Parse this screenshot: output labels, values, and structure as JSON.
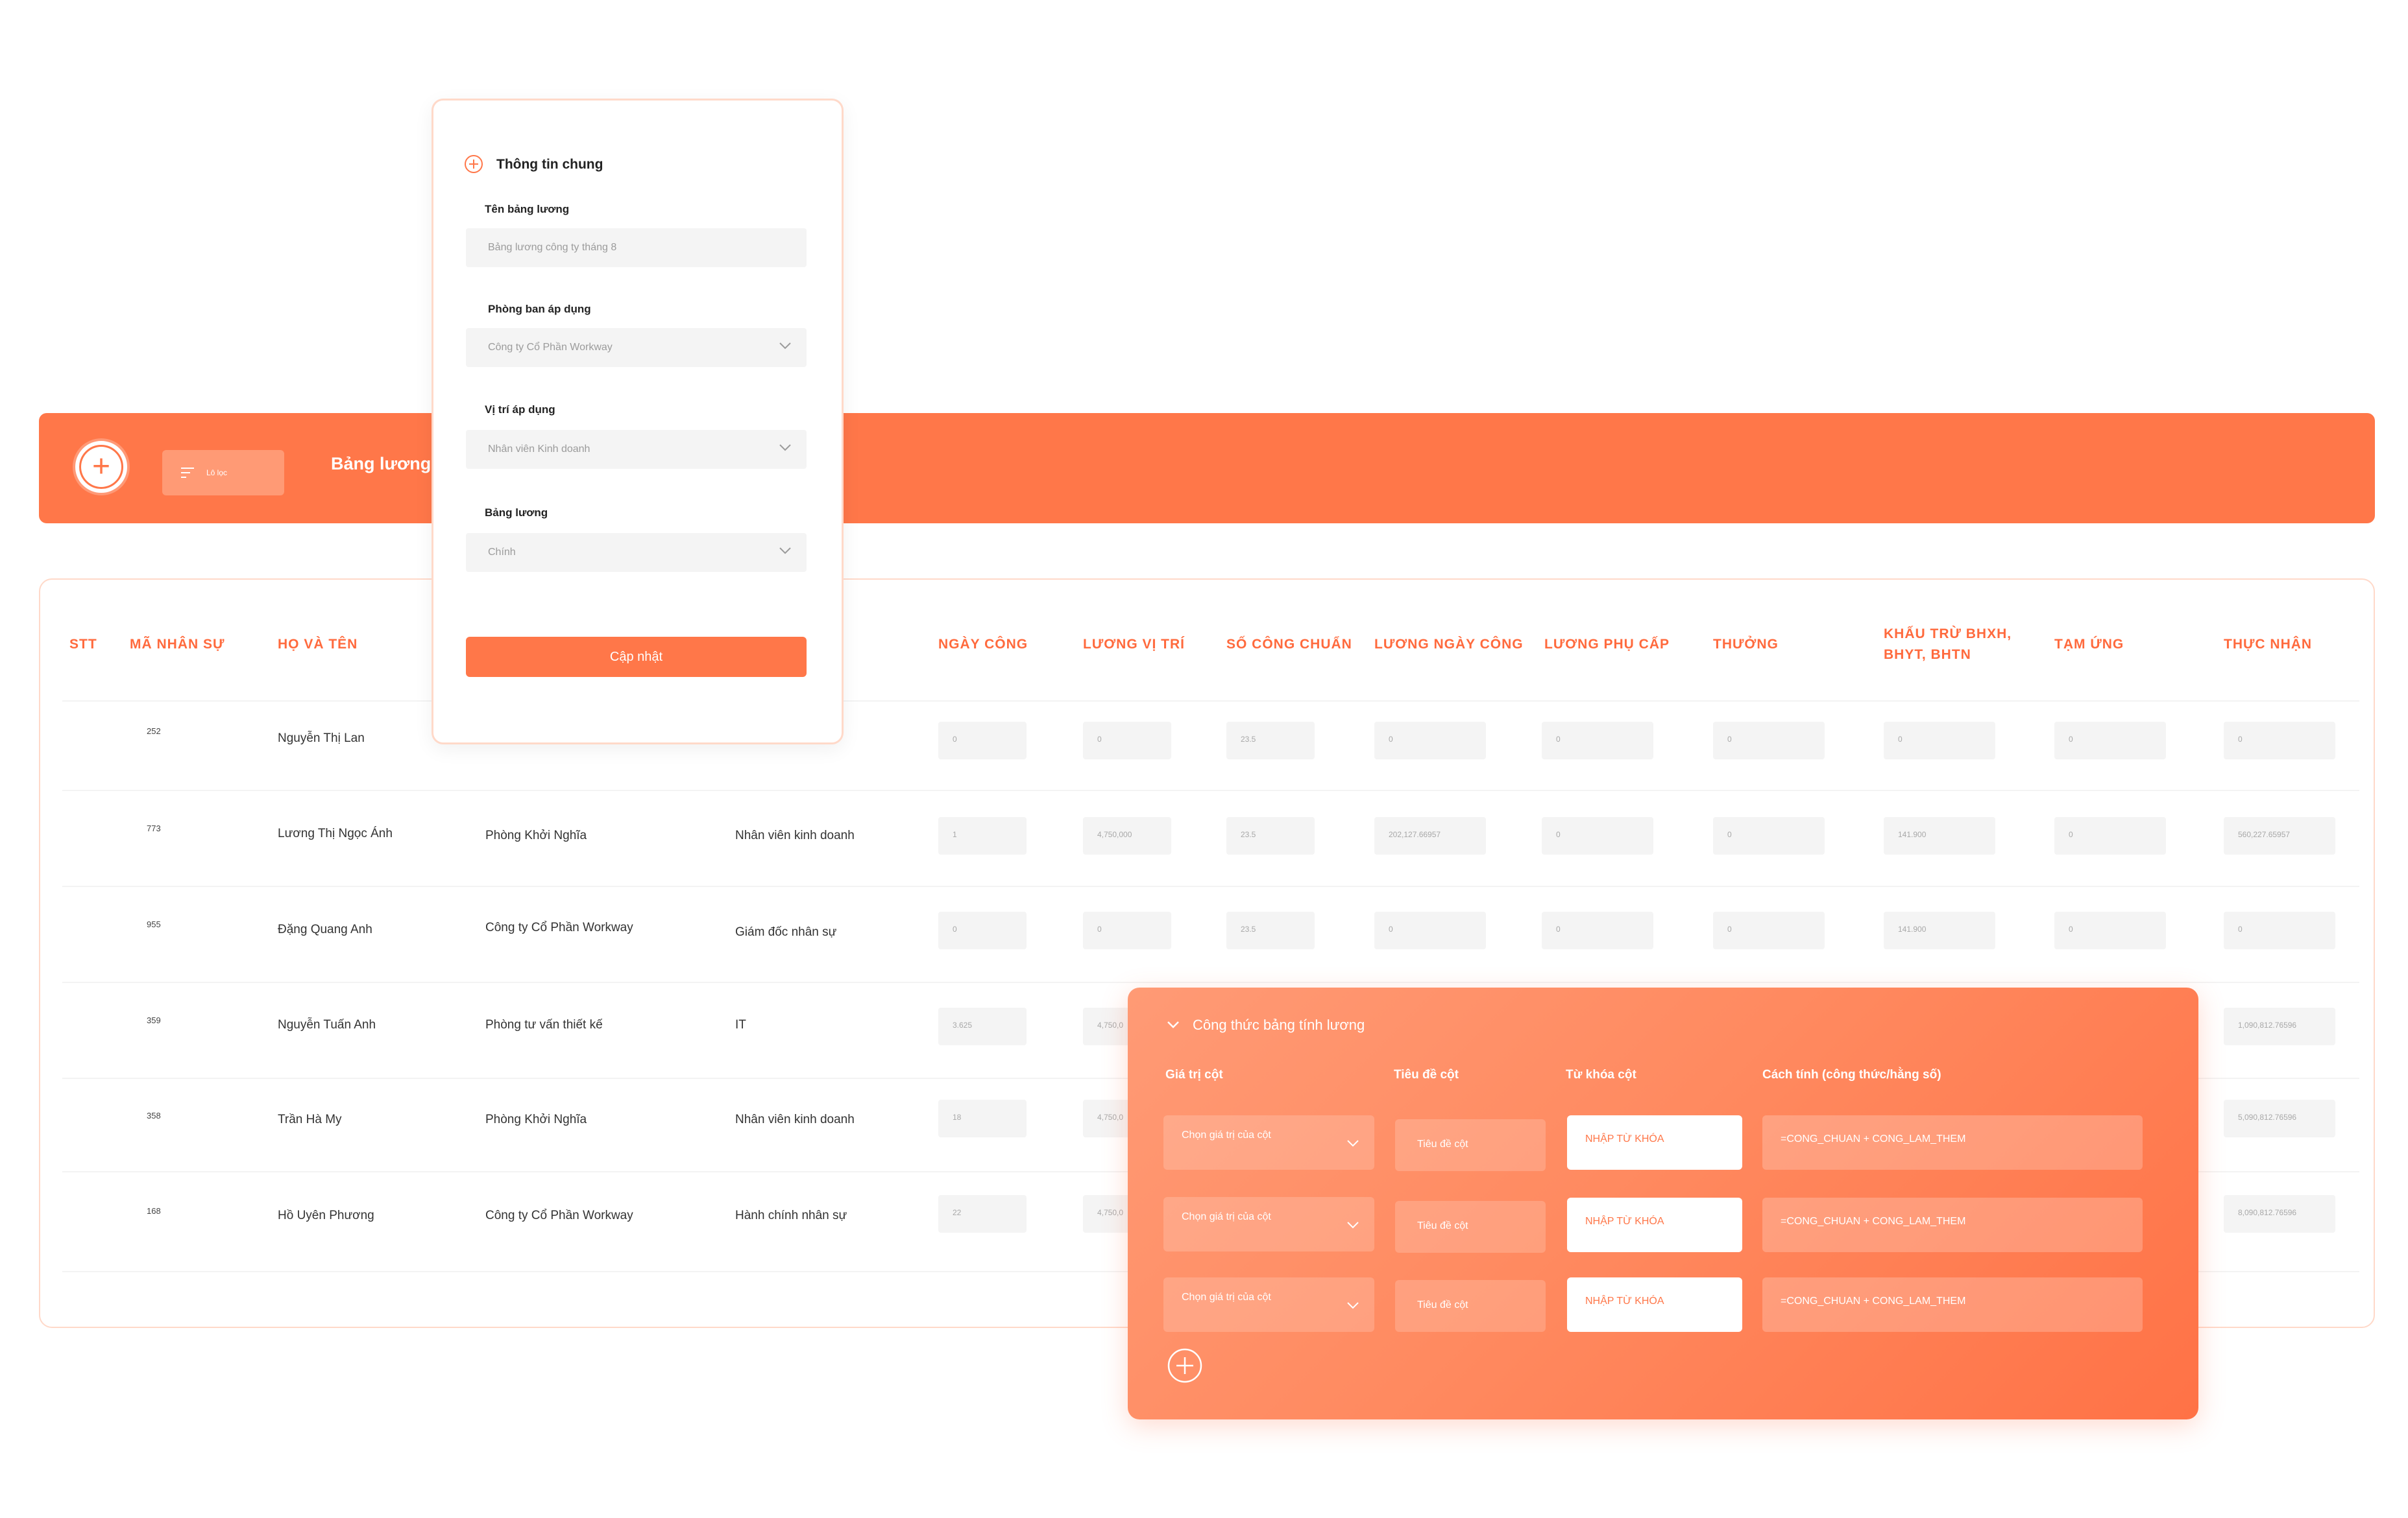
{
  "header": {
    "title": "Bảng lương",
    "filter_label": "Lô lọc"
  },
  "table": {
    "headers": {
      "stt": "STT",
      "employee_id": "MÃ NHÂN SỰ",
      "full_name": "HỌ VÀ TÊN",
      "work_days": "NGÀY CÔNG",
      "position_salary": "LƯƠNG VỊ TRÍ",
      "standard_days": "SỐ CÔNG CHUẨN",
      "daily_salary": "LƯƠNG NGÀY CÔNG",
      "allowance": "LƯƠNG PHỤ CẤP",
      "bonus": "THƯỞNG",
      "deductions": "KHẤU TRỪ BHXH, BHYT, BHTN",
      "advance": "TẠM ỨNG",
      "net": "THỰC NHẬN"
    },
    "rows": [
      {
        "id": "252",
        "name": "Nguyễn Thị Lan",
        "dept": "",
        "position": "",
        "work_days": "0",
        "position_salary": "0",
        "standard_days": "23.5",
        "daily_salary": "0",
        "allowance": "0",
        "bonus": "0",
        "deductions": "0",
        "advance": "0",
        "net": "0"
      },
      {
        "id": "773",
        "name": "Lương Thị Ngọc Ánh",
        "dept": "Phòng Khởi Nghĩa",
        "position": "Nhân viên kinh doanh",
        "work_days": "1",
        "position_salary": "4,750,000",
        "standard_days": "23.5",
        "daily_salary": "202,127.66957",
        "allowance": "0",
        "bonus": "0",
        "deductions": "141.900",
        "advance": "0",
        "net": "560,227.65957"
      },
      {
        "id": "955",
        "name": "Đặng Quang Anh",
        "dept": "Công ty Cổ Phần Workway",
        "position": "Giám đốc nhân sự",
        "work_days": "0",
        "position_salary": "0",
        "standard_days": "23.5",
        "daily_salary": "0",
        "allowance": "0",
        "bonus": "0",
        "deductions": "141.900",
        "advance": "0",
        "net": "0"
      },
      {
        "id": "359",
        "name": "Nguyễn Tuấn Anh",
        "dept": "Phòng tư vấn thiết kế",
        "position": "IT",
        "work_days": "3.625",
        "position_salary": "4,750,0",
        "net": "1,090,812.76596"
      },
      {
        "id": "358",
        "name": "Trần Hà My",
        "dept": "Phòng Khởi Nghĩa",
        "position": "Nhân viên kinh doanh",
        "work_days": "18",
        "position_salary": "4,750,0",
        "net": "5,090,812.76596"
      },
      {
        "id": "168",
        "name": "Hồ Uyên Phương",
        "dept": "Công ty Cổ Phần Workway",
        "position": "Hành chính nhân sự",
        "work_days": "22",
        "position_salary": "4,750,0",
        "net": "8,090,812.76596"
      }
    ]
  },
  "form": {
    "section_title": "Thông tin chung",
    "name_label": "Tên bảng lương",
    "name_value": "Bảng lương công ty tháng 8",
    "dept_label": "Phòng ban áp dụng",
    "dept_value": "Công ty Cổ Phần Workway",
    "position_label": "Vị trí áp dụng",
    "position_value": "Nhân viên Kinh doanh",
    "payroll_label": "Bảng lương",
    "payroll_value": "Chính",
    "update_button": "Cập nhật"
  },
  "formula": {
    "title": "Công thức bảng tính lương",
    "col_value_label": "Giá trị cột",
    "col_title_label": "Tiêu đề cột",
    "col_key_label": "Từ khóa cột",
    "col_formula_label": "Cách tính (công thức/hằng số)",
    "rows": [
      {
        "select": "Chọn giá trị của cột",
        "title": "Tiêu đề cột",
        "key": "NHẬP TỪ KHÓA",
        "formula": "=CONG_CHUAN + CONG_LAM_THEM"
      },
      {
        "select": "Chọn giá trị của cột",
        "title": "Tiêu đề cột",
        "key": "NHẬP TỪ KHÓA",
        "formula": "=CONG_CHUAN + CONG_LAM_THEM"
      },
      {
        "select": "Chọn giá trị của cột",
        "title": "Tiêu đề cột",
        "key": "NHẬP TỪ KHÓA",
        "formula": "=CONG_CHUAN + CONG_LAM_THEM"
      }
    ]
  },
  "colors": {
    "accent": "#ff7749",
    "accent_text": "#ff6a3d",
    "border": "#ffd9c9"
  },
  "icons": {
    "add": "plus-circle-icon",
    "filter": "filter-lines-icon",
    "chevron": "chevron-down-icon"
  }
}
